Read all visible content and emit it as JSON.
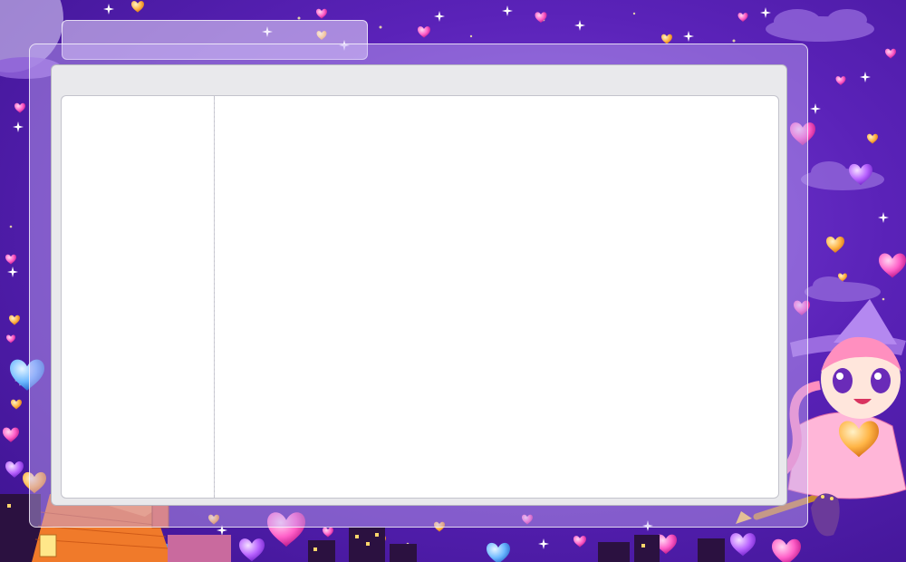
{
  "window": {
    "title": "",
    "sidebar_content": "",
    "main_content": ""
  },
  "theme": {
    "sky": "#5a22b8",
    "frame": "#c4aaf5",
    "panel": "#ffffff",
    "window_chrome": "#e9e9ec"
  },
  "decorations": {
    "illustration": "magical-girl-witch-on-broom",
    "motifs": [
      "heart-icon",
      "sparkle-icon",
      "cloud-icon",
      "house-icon",
      "cat-icon"
    ]
  }
}
